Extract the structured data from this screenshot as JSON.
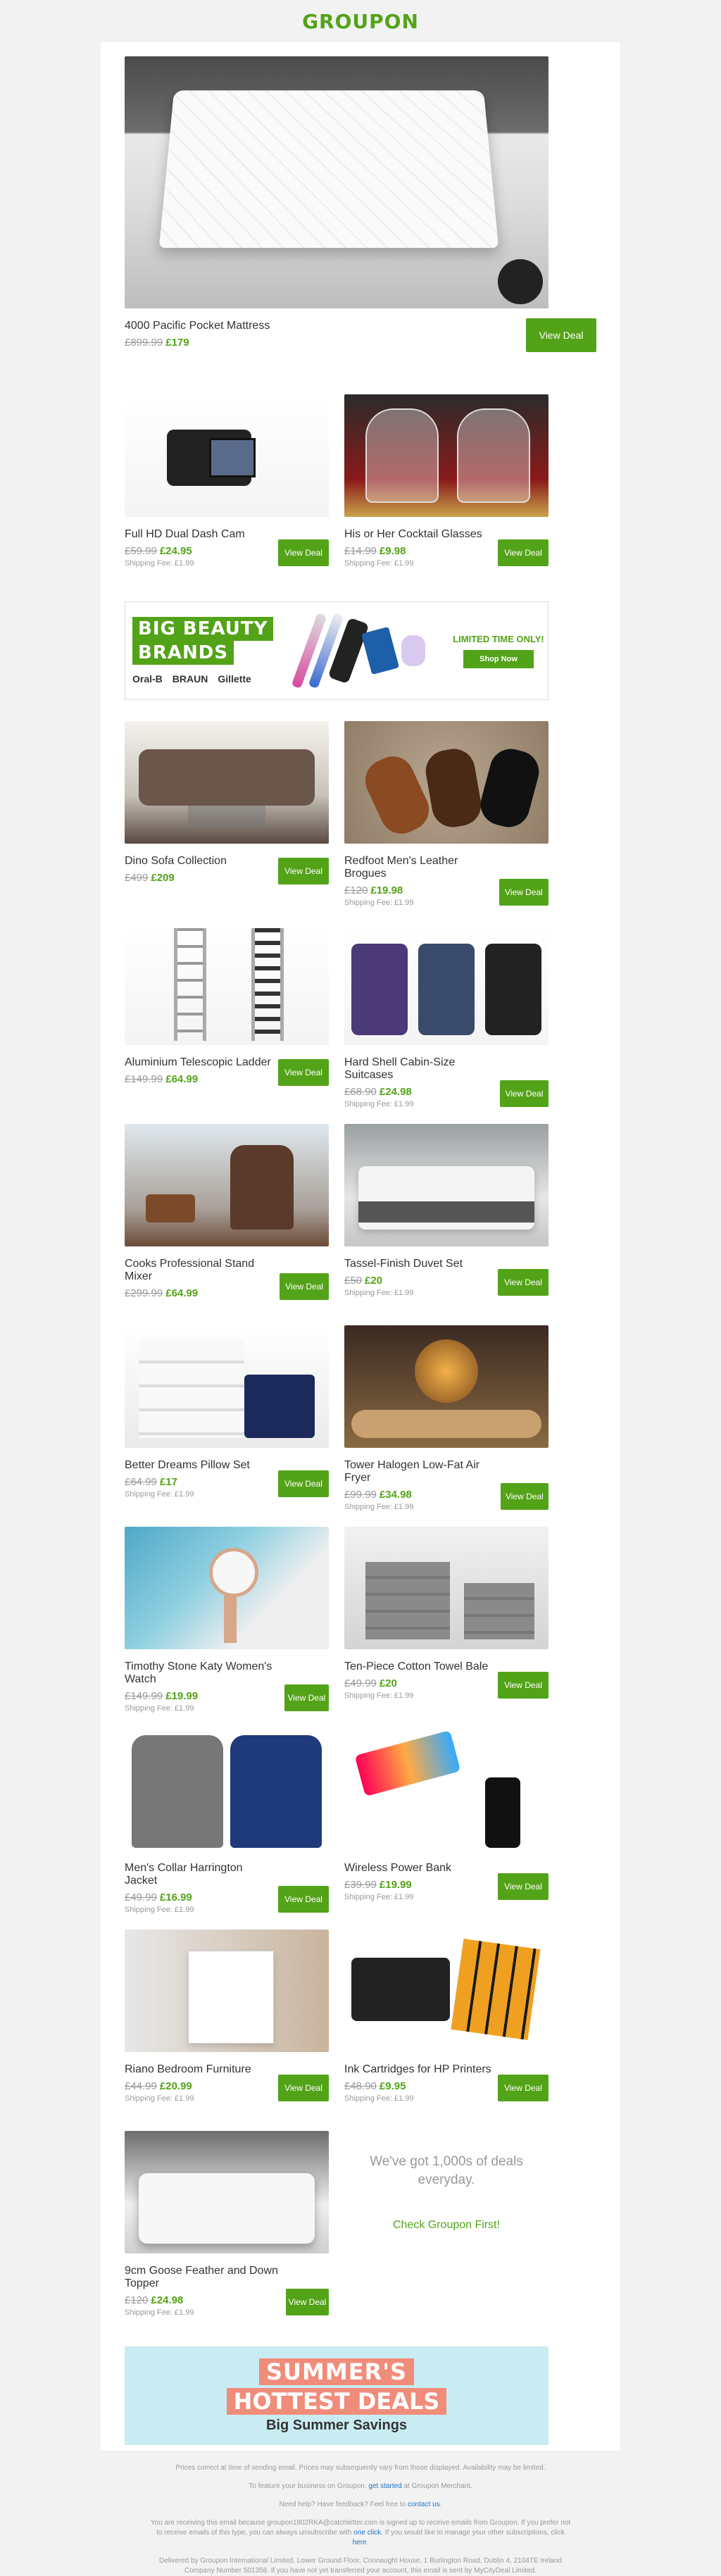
{
  "header": {
    "logo": "GROUPON"
  },
  "hero": {
    "title": "4000 Pacific Pocket Mattress",
    "old_price": "£899.99",
    "new_price": "£179",
    "button": "View Deal"
  },
  "deals": [
    {
      "title": "Full HD Dual Dash Cam",
      "old_price": "£59.99",
      "new_price": "£24.95",
      "shipping": "Shipping Fee: £1.99",
      "button": "View Deal"
    },
    {
      "title": "His or Her Cocktail Glasses",
      "old_price": "£14.99",
      "new_price": "£9.98",
      "shipping": "Shipping Fee: £1.99",
      "button": "View Deal"
    },
    {
      "title": "Dino Sofa Collection",
      "old_price": "£499",
      "new_price": "£209",
      "shipping": "",
      "button": "View Deal"
    },
    {
      "title": "Redfoot Men's Leather Brogues",
      "old_price": "£120",
      "new_price": "£19.98",
      "shipping": "Shipping Fee: £1.99",
      "button": "View Deal"
    },
    {
      "title": "Aluminium Telescopic Ladder",
      "old_price": "£149.99",
      "new_price": "£64.99",
      "shipping": "",
      "button": "View Deal"
    },
    {
      "title": "Hard Shell Cabin-Size Suitcases",
      "old_price": "£68.90",
      "new_price": "£24.98",
      "shipping": "Shipping Fee: £1.99",
      "button": "View Deal"
    },
    {
      "title": "Cooks Professional Stand Mixer",
      "old_price": "£299.99",
      "new_price": "£64.99",
      "shipping": "",
      "button": "View Deal"
    },
    {
      "title": "Tassel-Finish Duvet Set",
      "old_price": "£50",
      "new_price": "£20",
      "shipping": "Shipping Fee: £1.99",
      "button": "View Deal"
    },
    {
      "title": "Better Dreams Pillow Set",
      "old_price": "£64.99",
      "new_price": "£17",
      "shipping": "Shipping Fee: £1.99",
      "button": "View Deal"
    },
    {
      "title": "Tower Halogen Low-Fat Air Fryer",
      "old_price": "£99.99",
      "new_price": "£34.98",
      "shipping": "Shipping Fee: £1.99",
      "button": "View Deal"
    },
    {
      "title": "Timothy Stone Katy Women's Watch",
      "old_price": "£149.99",
      "new_price": "£19.99",
      "shipping": "Shipping Fee: £1.99",
      "button": "View Deal"
    },
    {
      "title": "Ten-Piece Cotton Towel Bale",
      "old_price": "£49.99",
      "new_price": "£20",
      "shipping": "Shipping Fee: £1.99",
      "button": "View Deal"
    },
    {
      "title": "Men's Collar Harrington Jacket",
      "old_price": "£49.99",
      "new_price": "£16.99",
      "shipping": "Shipping Fee: £1.99",
      "button": "View Deal"
    },
    {
      "title": "Wireless Power Bank",
      "old_price": "£39.99",
      "new_price": "£19.99",
      "shipping": "Shipping Fee: £1.99",
      "button": "View Deal"
    },
    {
      "title": "Riano Bedroom Furniture",
      "old_price": "£44.99",
      "new_price": "£20.99",
      "shipping": "Shipping Fee: £1.99",
      "button": "View Deal"
    },
    {
      "title": "Ink Cartridges for HP Printers",
      "old_price": "£48.90",
      "new_price": "£9.95",
      "shipping": "Shipping Fee: £1.99",
      "button": "View Deal"
    },
    {
      "title": "9cm Goose Feather and Down Topper",
      "old_price": "£120",
      "new_price": "£24.98",
      "shipping": "Shipping Fee: £1.99",
      "button": "View Deal"
    }
  ],
  "beauty_banner": {
    "line1": "BIG BEAUTY",
    "line2": "BRANDS",
    "brands": [
      "Oral-B",
      "BRAUN",
      "Gillette"
    ],
    "lto": "LIMITED TIME ONLY!",
    "cta": "Shop Now"
  },
  "promo": {
    "text": "We've got 1,000s of deals everyday.",
    "link": "Check Groupon First!"
  },
  "summer": {
    "line1": "SUMMER'S",
    "line2": "HOTTEST DEALS",
    "line3": "Big Summer Savings"
  },
  "footer": {
    "disclaimer": "Prices correct at time of sending email. Prices may subsequently vary from those displayed. Availability may be limited.",
    "feature_pre": "To feature your business on Groupon,",
    "feature_link": "get started",
    "feature_post": "at Groupon Merchant.",
    "help_pre": "Need help? Have feedback? Feel free to",
    "help_link": "contact us",
    "unsub_pre": "You are receiving this email because groupon1802RKA@catchletter.com is signed up to receive emails from Groupon. If you prefer not to receive emails of this type, you can always unsubscribe with",
    "unsub_link1": "one click",
    "unsub_mid": ". If you would like to manage your other subscriptions, click",
    "unsub_link2": "here",
    "address": "Delivered by Groupon International Limited, Lower Ground Floor, Connaught House, 1 Burlington Road, Dublin 4, 2104TE Ireland Company Number 501358. If you have not yet transferred your account, this email is sent by MyCityDeal Limited."
  },
  "colors": {
    "brand_green": "#53a318",
    "page_bg": "#f2f2f2",
    "summer_bg": "#c9ecf2",
    "summer_accent": "#f08c7a"
  }
}
